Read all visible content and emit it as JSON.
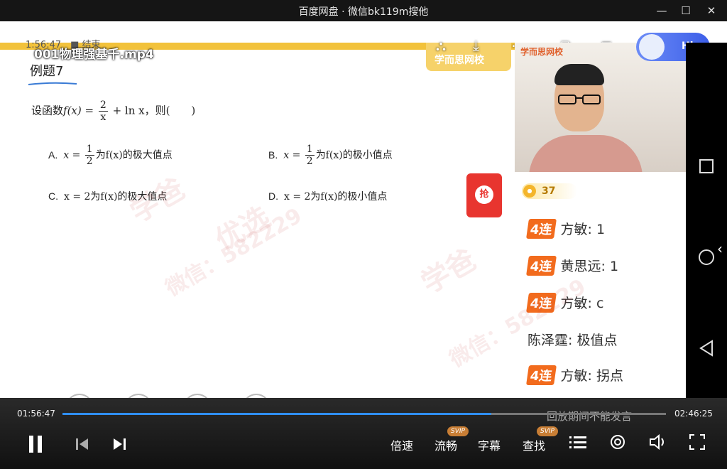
{
  "window": {
    "title": "百度网盘 · 微信bk119m搜他"
  },
  "overlay": {
    "elapsed_top": "1:56:47",
    "status_top": "结束",
    "filename": "001物理强基千.mp4"
  },
  "slide": {
    "example_title": "例题7",
    "question_prefix": "设函数",
    "question_expr_left": "f(x) =",
    "question_frac_num": "2",
    "question_frac_den": "x",
    "question_expr_right": "+ ln x，则(　　)",
    "options": [
      {
        "label": "A.",
        "pre": "x =",
        "num": "1",
        "den": "2",
        "post": "为f(x)的极大值点"
      },
      {
        "label": "B.",
        "pre": "x =",
        "num": "1",
        "den": "2",
        "post": "为f(x)的极小值点"
      },
      {
        "label": "C.",
        "text": "x = 2为f(x)的极大值点"
      },
      {
        "label": "D.",
        "text": "x = 2为f(x)的极小值点"
      }
    ],
    "brand": "学而思网校"
  },
  "teacher": {
    "brand": "学而思网校"
  },
  "chat": {
    "coin_count": "37",
    "messages": [
      {
        "streak": "4连",
        "user": "方敏",
        "text": "1"
      },
      {
        "streak": "4连",
        "user": "黄思远",
        "text": "1"
      },
      {
        "streak": "4连",
        "user": "方敏",
        "text": "c"
      },
      {
        "streak": "",
        "user": "陈泽霆",
        "text": "极值点"
      },
      {
        "streak": "4连",
        "user": "方敏",
        "text": "拐点"
      }
    ],
    "notice": "回放期间不能发言"
  },
  "grab_label": "抢",
  "hi_label": "Hi",
  "choices": [
    "A",
    "B",
    "C",
    "D"
  ],
  "player": {
    "current_time": "01:56:47",
    "total_time": "02:46:25",
    "progress": 0.71,
    "speed_label": "倍速",
    "quality_label": "流畅",
    "subtitle_label": "字幕",
    "search_label": "查找",
    "svip_badge": "SVIP"
  },
  "watermark": {
    "line1": "学爸",
    "line2": "微信：582229",
    "line3": "优选"
  },
  "accent": "#2f8ef4"
}
